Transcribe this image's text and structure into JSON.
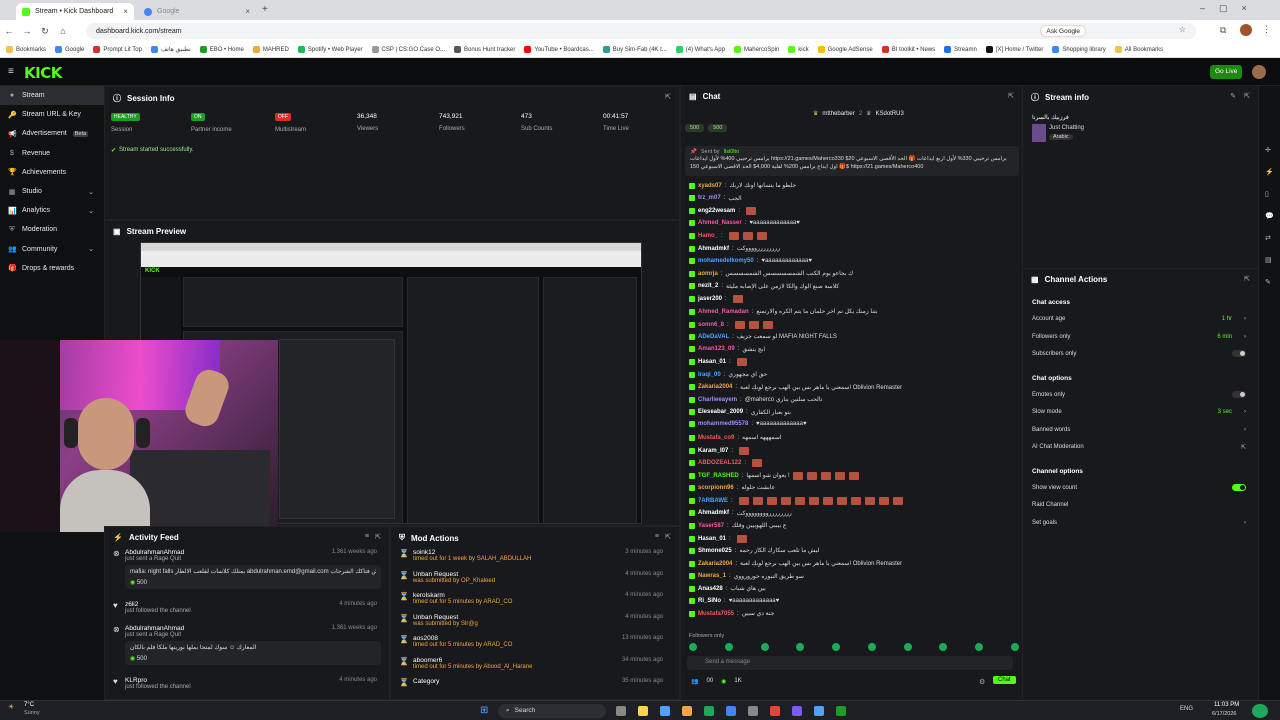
{
  "browser": {
    "tabs": [
      {
        "label": "Stream • Kick Dashboard"
      },
      {
        "label": "Google"
      }
    ],
    "url": "dashboard.kick.com/stream",
    "ask_google": "Ask Google",
    "bookmarks": [
      "Bookmarks",
      "Google",
      "Prompt Lit Top",
      "تطبيق هاتف",
      "EBO • Home",
      "MAHRED",
      "Spotify • Web Player",
      "CSP | CS:GO Case O...",
      "Bonus Hunt tracker",
      "YouTube • Boardcas...",
      "Buy Sim-Fab (4K t...",
      "(4) What's App",
      "MahercoSpin",
      "kick",
      "Google AdSense",
      "BI toolkit • News",
      "Streamn",
      "[X] Home / Twitter",
      "Shopping library",
      "All Bookmarks"
    ]
  },
  "kick": {
    "logo": "KICK",
    "go_live": "Go Live"
  },
  "sidebar": {
    "items": [
      {
        "label": "Stream"
      },
      {
        "label": "Stream URL & Key"
      },
      {
        "label": "Advertisement",
        "beta": "Beta"
      },
      {
        "label": "Revenue"
      },
      {
        "label": "Achievements"
      },
      {
        "label": "Studio"
      },
      {
        "label": "Analytics"
      },
      {
        "label": "Moderation"
      },
      {
        "label": "Community"
      },
      {
        "label": "Drops & rewards"
      }
    ]
  },
  "session": {
    "title": "Session Info",
    "stats": [
      {
        "value": "HEALTHY",
        "label": "Session",
        "color": "#1b9e23"
      },
      {
        "value": "ON",
        "label": "Partner income",
        "color": "#1b9e23"
      },
      {
        "value": "OFF",
        "label": "Multistream",
        "color": "#d93025"
      },
      {
        "value": "36,348",
        "label": "Viewers"
      },
      {
        "value": "743,921",
        "label": "Followers"
      },
      {
        "value": "473",
        "label": "Sub Counts"
      },
      {
        "value": "00:41:57",
        "label": "Time Live"
      }
    ],
    "notice": "Stream started successfully."
  },
  "preview": {
    "title": "Stream Preview"
  },
  "activity": {
    "title": "Activity Feed",
    "items": [
      {
        "user": "AbdulrahmanAhmad",
        "action": "just sent a Rage Quit",
        "ago": "1,361 weeks ago",
        "message": "mafia: night falls بمتلك كلاسات لقلعب الالظار abdulrahman.emd@gmail.com ما لاقيش فتاكك الشرحات",
        "amount": "500"
      },
      {
        "user": "z6li2",
        "action": "just followed the channel",
        "ago": "4 minutes ago"
      },
      {
        "user": "AbdulrahmanAhmad",
        "action": "just sent a Rage Quit",
        "ago": "1,361 weeks ago",
        "message": "المعارك ☺ سوك لمتجا بملها بوريتها ملكا فلم بالكان",
        "amount": "500"
      },
      {
        "user": "KLRpro",
        "action": "just followed the channel",
        "ago": "4 minutes ago"
      }
    ]
  },
  "mod": {
    "title": "Mod Actions",
    "items": [
      {
        "title": "soink12",
        "desc": "timed out for 1 week by SALAH_ABDULLAH",
        "ago": "3 minutes ago"
      },
      {
        "title": "Unban Request",
        "desc": "was submitted by OP_Khaleed",
        "ago": "4 minutes ago"
      },
      {
        "title": "kerolskarm",
        "desc": "timed out for 5 minutes by ARAD_CO",
        "ago": "4 minutes ago"
      },
      {
        "title": "Unban Request",
        "desc": "was submitted by Slr@g",
        "ago": "4 minutes ago"
      },
      {
        "title": "aos2008",
        "desc": "timed out for 5 minutes by ARAD_CO",
        "ago": "13 minutes ago"
      },
      {
        "title": "aboomer6",
        "desc": "timed out for 5 minutes by Abood_Al_Harane",
        "ago": "34 minutes ago"
      },
      {
        "title": "Category",
        "desc": "",
        "ago": "35 minutes ago"
      }
    ]
  },
  "chat": {
    "title": "Chat",
    "top_users": [
      "mtthebarber",
      "KSdotRU3"
    ],
    "top_counts": [
      "2",
      "1"
    ],
    "pills": [
      "500",
      "500"
    ],
    "pinned_by": "Sent by",
    "pinned_user": "Ilsl0lto",
    "pinned_text": "برامس ترحيبي 400% لأول ايداعات https://21.games/Maherco330 برامس ترحيبي 330% لأول اربع ايداعات 🎁 الحد الأقصى الاسبوعي 20$ 🎁 اول ايداع برامس 200% لقلية 4,000$ الحد الاقصى الاسبوعي 150$ https://21.games/Maherco400",
    "messages": [
      {
        "user": "xyads07",
        "text": "جلطو ما بتسانها اونك لاربك",
        "color": "#f2a541"
      },
      {
        "user": "trz_m07",
        "text": "الجب",
        "color": "#a38bff"
      },
      {
        "user": "eng22wesam",
        "text": "",
        "color": "#ffffff",
        "emotes": 1
      },
      {
        "user": "Ahmed_Nasser",
        "text": "♥aaaaaaaaaaaaa♥",
        "color": "#f25aa5"
      },
      {
        "user": "Hamo_",
        "text": "",
        "color": "#f25a5a",
        "emotes": 3
      },
      {
        "user": "Ahmadmkf",
        "text": "ررررررررووووكت",
        "color": "#ffffff"
      },
      {
        "user": "mohamedelkomy50",
        "text": "♥aaaaaaaaaaaaa♥",
        "color": "#4fa3ff"
      },
      {
        "user": "aomrja",
        "text": "ك بجاعو يوم الكنب الشمسسسسس الشمسسسس",
        "color": "#f2a541"
      },
      {
        "user": "nezit_2",
        "text": "كلاسة صنع الوك والكا لازمن على الإصابه مليئة",
        "color": "#ffffff"
      },
      {
        "user": "jaser200",
        "text": "",
        "color": "#ffffff",
        "emotes": 1
      },
      {
        "user": "Ahmed_Ramadan",
        "text": "بتنا زمنك يكل تم اخر حلمان ما يتم الكره والارتمنع",
        "color": "#f25aa5"
      },
      {
        "user": "somn6_8",
        "text": "",
        "color": "#f25aa5",
        "emotes": 3
      },
      {
        "user": "ADeDaVAL",
        "text": "لو سمعت جزيف MAFIA NIGHT FALLS",
        "color": "#4fa3ff"
      },
      {
        "user": "Aman123_09",
        "text": "ابچ يتشق",
        "color": "#f25aa5"
      },
      {
        "user": "Hasan_01",
        "text": "",
        "color": "#ffffff",
        "emotes": 1
      },
      {
        "user": "Iraqi_00",
        "text": "حق اي مجهوري",
        "color": "#4fa3ff"
      },
      {
        "user": "Zakaria2004",
        "text": "اسمعني يا ماهر بس بين الهب برجع لوبك لعبة Oblivion Remaster",
        "color": "#f2a541"
      },
      {
        "user": "Charlieeayem",
        "text": "@maherco تالحب سلتين بناري",
        "color": "#a38bff"
      },
      {
        "user": "Eleseabar_2009",
        "text": "بتو بعبار الكفاري",
        "color": "#ffffff"
      },
      {
        "user": "mohammed95578",
        "text": "♥aaaaaaaaaaaaa♥",
        "color": "#a38bff"
      },
      {
        "user": "Mustafa_co9",
        "text": "اسمهههه اسمهه",
        "color": "#f25a5a"
      },
      {
        "user": "Karam_I07",
        "text": "",
        "color": "#ffffff",
        "emotes": 1
      },
      {
        "user": "ABDOZEAL122",
        "text": "",
        "color": "#f25a5a",
        "emotes": 1
      },
      {
        "user": "TGF_RASHED",
        "text": "يعوان شو اسمها !",
        "color": "#53fc18",
        "emotes": 5
      },
      {
        "user": "scorpionn96",
        "text": "عابشت جلوله",
        "color": "#f2a541"
      },
      {
        "user": "7ARBAWE",
        "text": "",
        "color": "#4fa3ff",
        "emotes": 12
      },
      {
        "user": "Ahmadmkf",
        "text": "ررررررررووووووووكت",
        "color": "#ffffff"
      },
      {
        "user": "Yaser587",
        "text": "ع بيببي اللهوييين وفلك",
        "color": "#f25aa5"
      },
      {
        "user": "Hasan_01",
        "text": "",
        "color": "#ffffff",
        "emotes": 1
      },
      {
        "user": "Shmone025",
        "text": "ليش ما تلعب سكارك الكاز رحمه",
        "color": "#ffffff"
      },
      {
        "user": "Zakaria2004",
        "text": "اسمعني يا ماهر بس بين الهب برجع لوبك لعبة Oblivion Remaster",
        "color": "#f2a541"
      },
      {
        "user": "Nawras_1",
        "text": "سو طريق التبوره حورورووي",
        "color": "#f2a541"
      },
      {
        "user": "Anas428",
        "text": "بين هاي شباب",
        "color": "#ffffff"
      },
      {
        "user": "Ri_SiNo",
        "text": "♥aaaaaaaaaaaaa♥",
        "color": "#ffffff"
      },
      {
        "user": "Mustafa7055",
        "text": "جنة دي سيين",
        "color": "#f25a5a"
      }
    ],
    "followers_only": "Followers only",
    "input_placeholder": "Send a message",
    "viewers": "00",
    "kicks": "1K",
    "send": "Chat"
  },
  "streaminfo": {
    "title": "Stream info",
    "stream_title": "فرزبيك بالسرنا",
    "category": "Just Chatting",
    "tag": "Arabic"
  },
  "actions": {
    "title": "Channel Actions",
    "sections": [
      {
        "heading": "Chat access",
        "rows": [
          {
            "label": "Account age",
            "value": "1 hr",
            "kind": "chev"
          },
          {
            "label": "Followers only",
            "value": "6 min",
            "kind": "chev"
          },
          {
            "label": "Subscribers only",
            "value": "",
            "kind": "toggle",
            "on": false
          }
        ]
      },
      {
        "heading": "Chat options",
        "rows": [
          {
            "label": "Emotes only",
            "value": "",
            "kind": "toggle",
            "on": false
          },
          {
            "label": "Slow mode",
            "value": "3 sec",
            "kind": "chev"
          },
          {
            "label": "Banned words",
            "value": "",
            "kind": "chev"
          },
          {
            "label": "AI Chat Moderation",
            "value": "",
            "kind": "ext"
          }
        ]
      },
      {
        "heading": "Channel options",
        "rows": [
          {
            "label": "Show view count",
            "value": "",
            "kind": "toggle",
            "on": true
          },
          {
            "label": "Raid Channel",
            "value": "",
            "kind": "none"
          },
          {
            "label": "Set goals",
            "value": "",
            "kind": "chev"
          }
        ]
      }
    ]
  },
  "taskbar": {
    "weather_temp": "7°C",
    "weather_desc": "Sunny",
    "search": "Search",
    "lang": "ENG",
    "time": "11:03 PM",
    "date": "6/17/2026"
  }
}
